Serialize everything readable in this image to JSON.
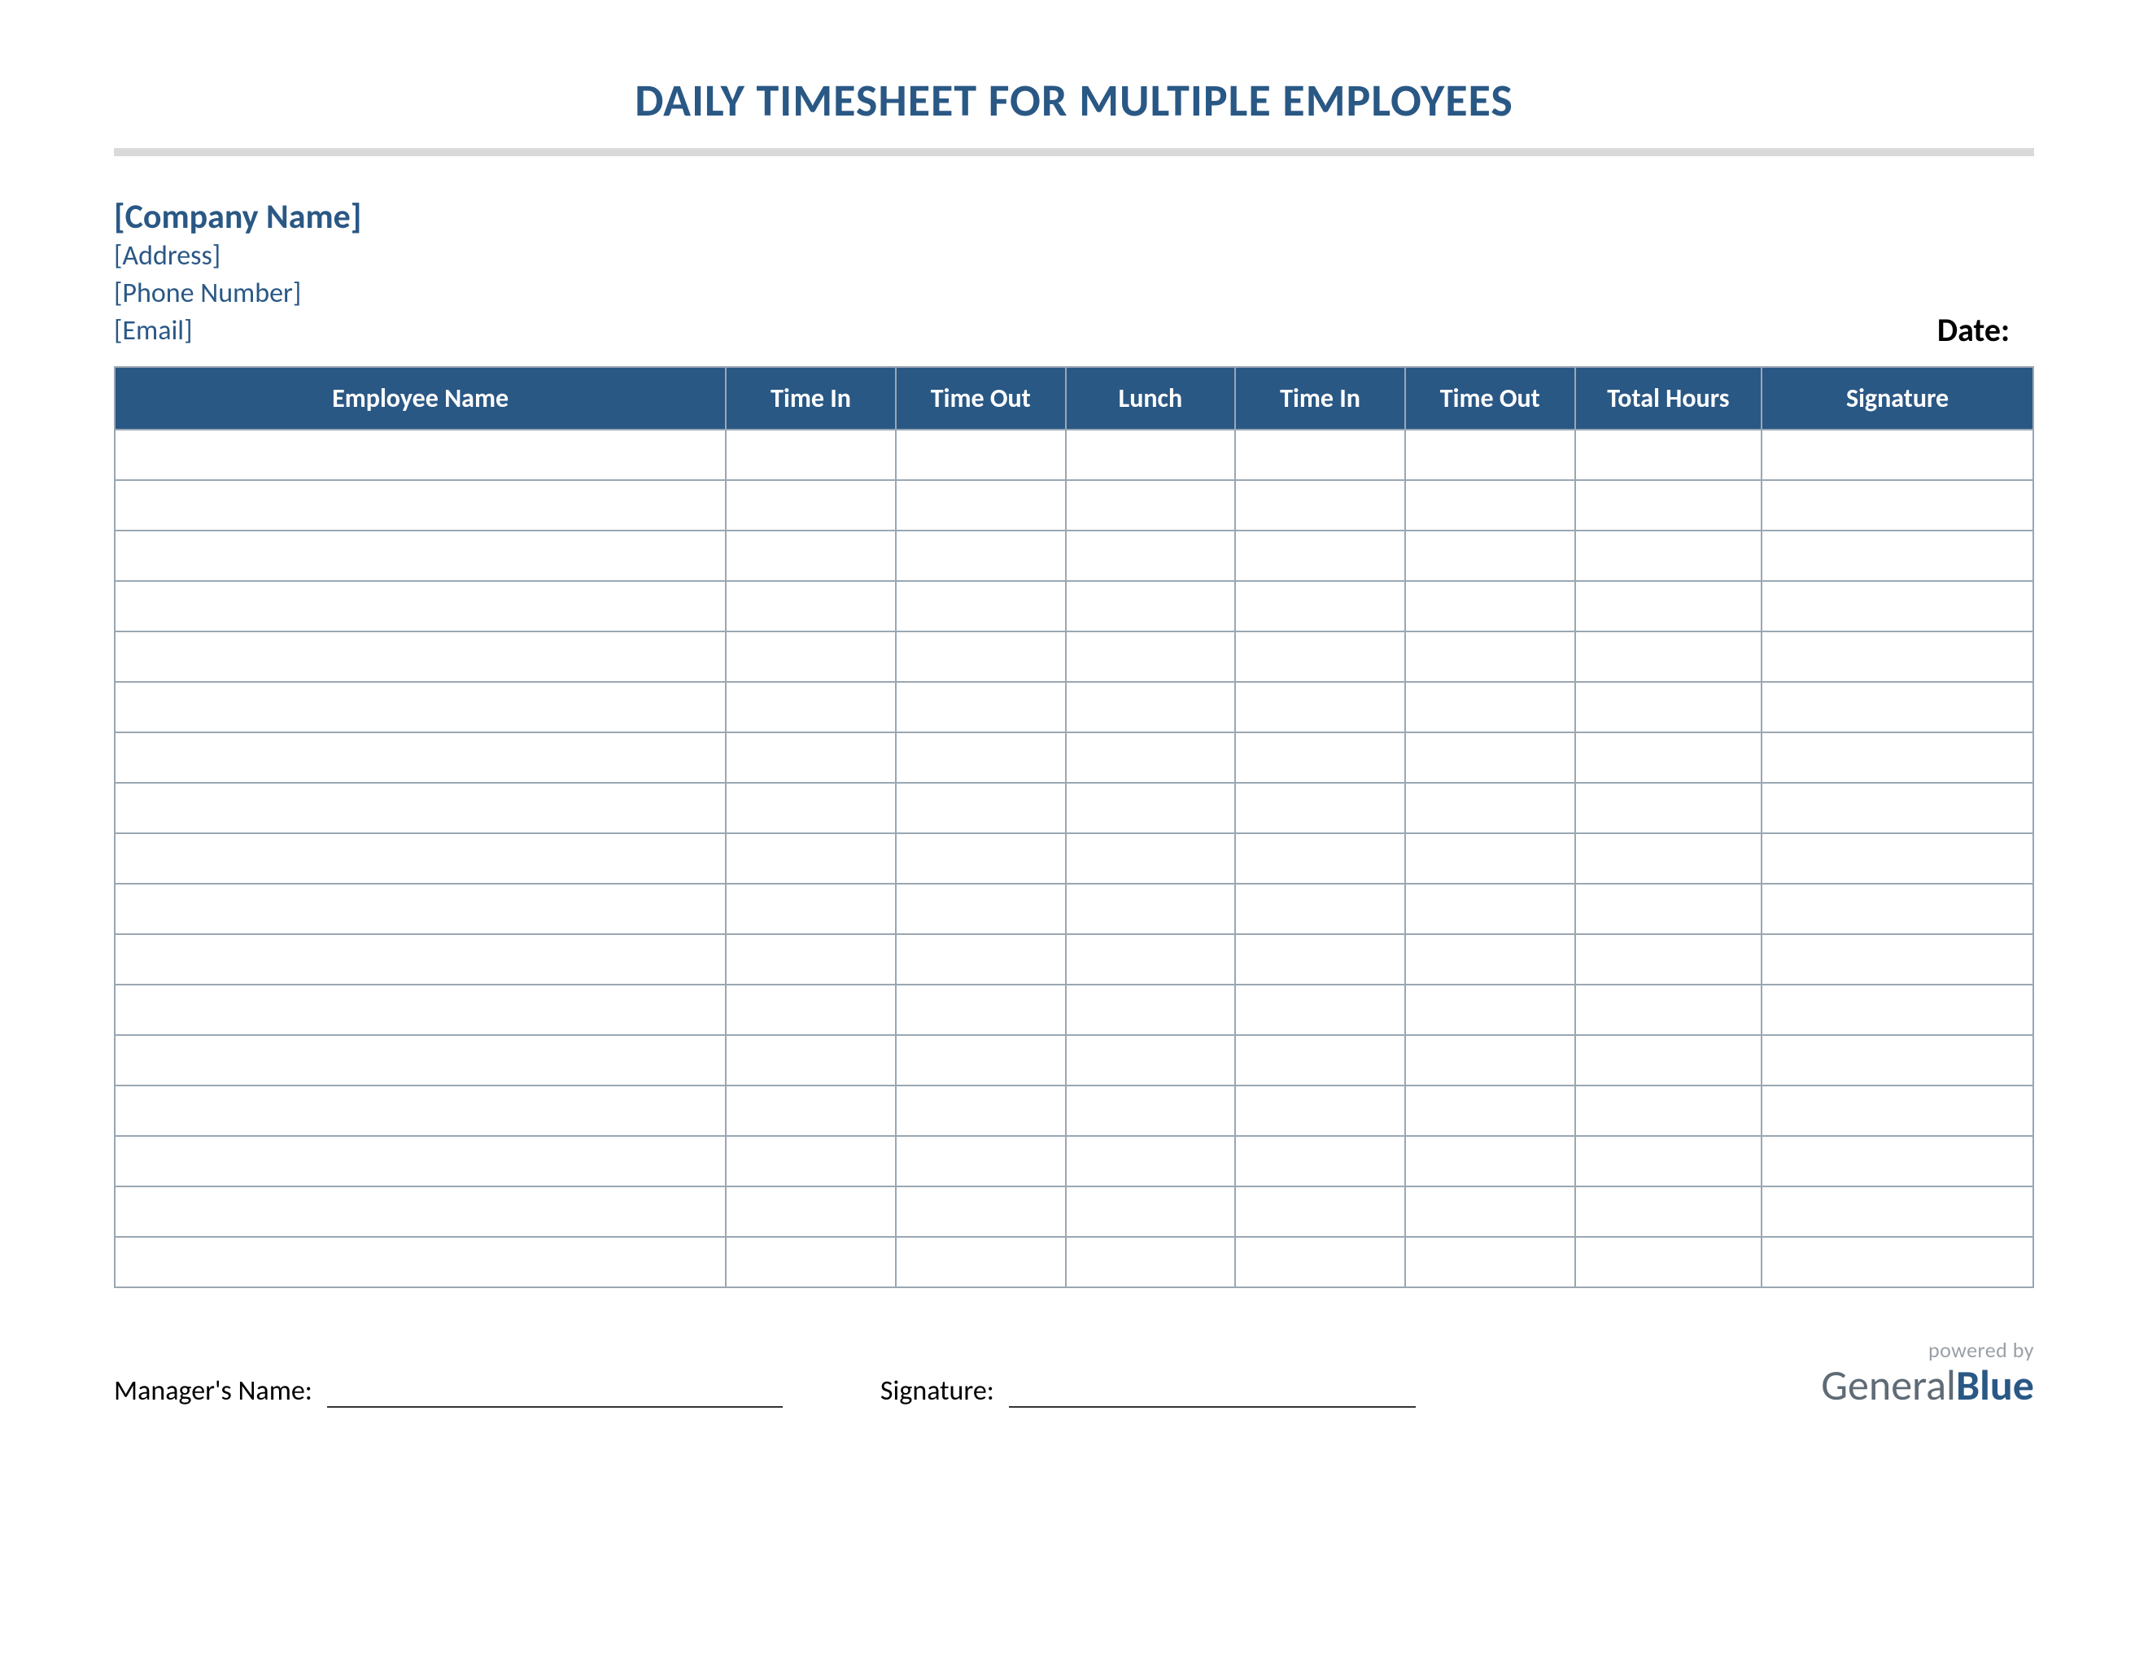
{
  "title": "DAILY TIMESHEET FOR MULTIPLE EMPLOYEES",
  "company": {
    "name": "[Company Name]",
    "address": "[Address]",
    "phone": "[Phone Number]",
    "email": "[Email]"
  },
  "date_label": "Date:",
  "table": {
    "headers": [
      "Employee Name",
      "Time In",
      "Time Out",
      "Lunch",
      "Time In",
      "Time Out",
      "Total Hours",
      "Signature"
    ],
    "row_count": 17
  },
  "footer": {
    "manager_label": "Manager's Name:",
    "signature_label": "Signature:"
  },
  "branding": {
    "powered": "powered by",
    "word1": "General",
    "word2": "Blue"
  },
  "colors": {
    "accent": "#2a5885",
    "rule": "#d9d9d9",
    "border": "#9aa7b3"
  }
}
